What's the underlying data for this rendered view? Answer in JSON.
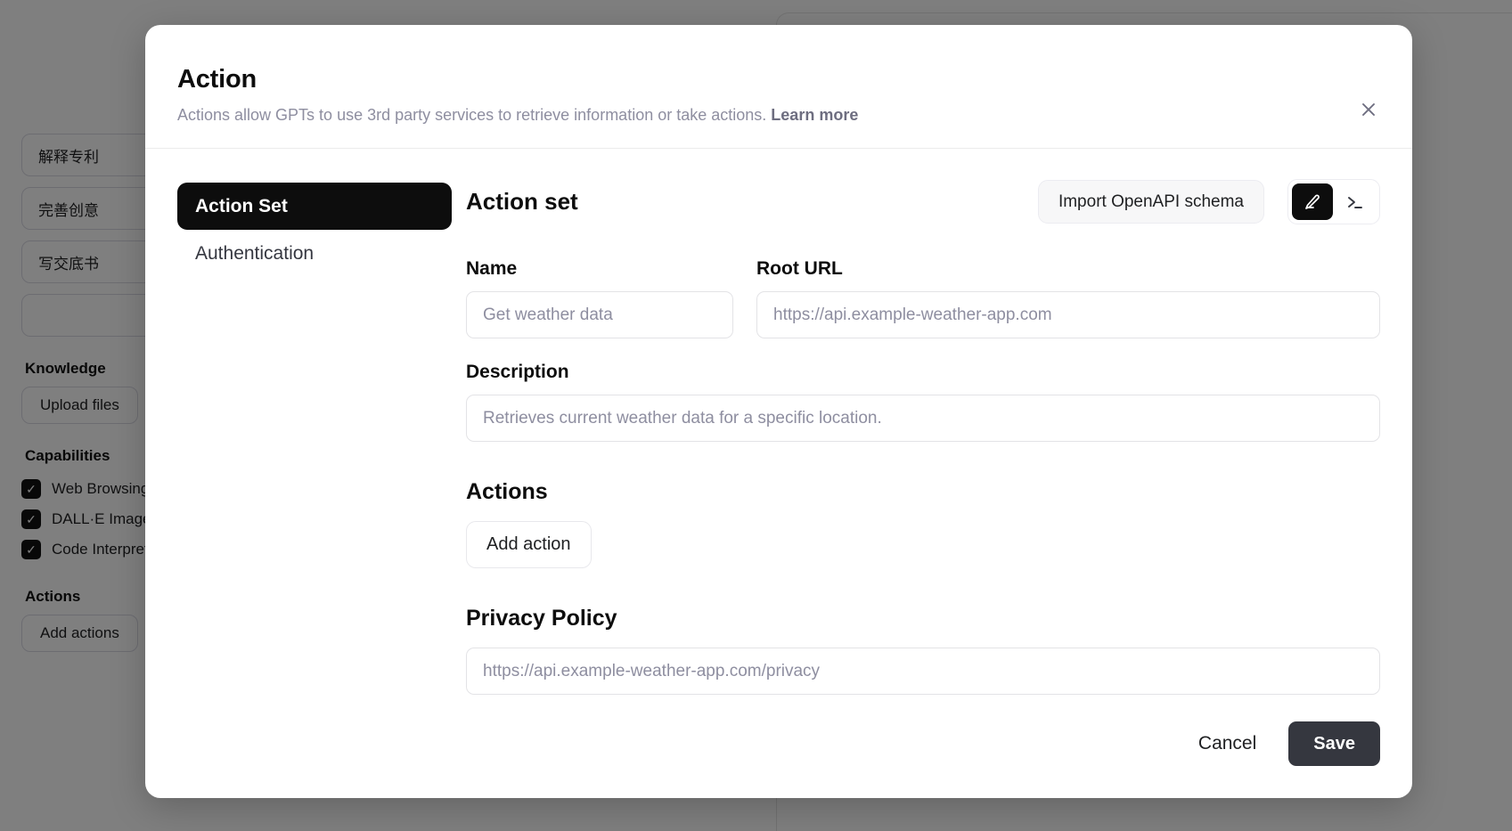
{
  "background": {
    "prompt_chips": [
      "解释专利",
      "完善创意",
      "写交底书",
      ""
    ],
    "knowledge": {
      "title": "Knowledge",
      "upload_label": "Upload files"
    },
    "capabilities": {
      "title": "Capabilities",
      "items": [
        {
          "label": "Web Browsing",
          "checked": true
        },
        {
          "label": "DALL·E Image Generation",
          "checked": true
        },
        {
          "label": "Code Interpreter",
          "checked": true
        }
      ]
    },
    "actions": {
      "title": "Actions",
      "add_label": "Add actions"
    },
    "composer": {
      "mic_icon": "microphone-icon",
      "send_icon": "arrow-up-icon"
    }
  },
  "modal": {
    "title": "Action",
    "subtitle": "Actions allow GPTs to use 3rd party services to retrieve information or take actions.",
    "learn_more": "Learn more",
    "close_icon": "close-icon",
    "nav": {
      "items": [
        {
          "label": "Action Set",
          "active": true
        },
        {
          "label": "Authentication",
          "active": false
        }
      ]
    },
    "panel": {
      "title": "Action set",
      "import_button": "Import OpenAPI schema",
      "view_toggle": [
        {
          "icon": "pencil-icon",
          "active": true
        },
        {
          "icon": "terminal-icon",
          "active": false
        }
      ],
      "fields": {
        "name": {
          "label": "Name",
          "value": "",
          "placeholder": "Get weather data"
        },
        "root_url": {
          "label": "Root URL",
          "value": "",
          "placeholder": "https://api.example-weather-app.com"
        },
        "description": {
          "label": "Description",
          "value": "",
          "placeholder": "Retrieves current weather data for a specific location."
        },
        "privacy_policy": {
          "label": "Privacy Policy",
          "value": "",
          "placeholder": "https://api.example-weather-app.com/privacy"
        }
      },
      "actions_section": {
        "title": "Actions",
        "add_button": "Add action"
      }
    },
    "footer": {
      "cancel": "Cancel",
      "save": "Save"
    }
  }
}
